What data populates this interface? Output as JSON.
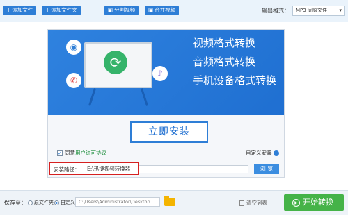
{
  "toolbar": {
    "add_file_label": "添加文件",
    "add_folder_label": "添加文件夹",
    "split_video_label": "分割视频",
    "merge_video_label": "合并视频",
    "output_format_label": "输出格式：",
    "output_format_value": "MP3  同原文件"
  },
  "installer": {
    "features": [
      "视频格式转换",
      "音频格式转换",
      "手机设备格式转换"
    ],
    "install_button_label": "立即安装",
    "agree_prefix": "同意",
    "license_link": "用户许可协议",
    "custom_install_label": "自定义安装",
    "path_label": "安装路径：",
    "path_value": "E:\\迅捷视频转换器",
    "browse_label": "浏 览"
  },
  "bottom": {
    "save_to_label": "保存至：",
    "radio_original_label": "原文件夹",
    "radio_custom_label": "自定义",
    "save_path_value": "C:\\Users\\Administrator\\Desktop",
    "clear_list_label": "清空列表",
    "start_button_label": "开始转换"
  },
  "colors": {
    "accent": "#2e7ed6",
    "start_green": "#45b348",
    "highlight_red": "#d62020"
  }
}
